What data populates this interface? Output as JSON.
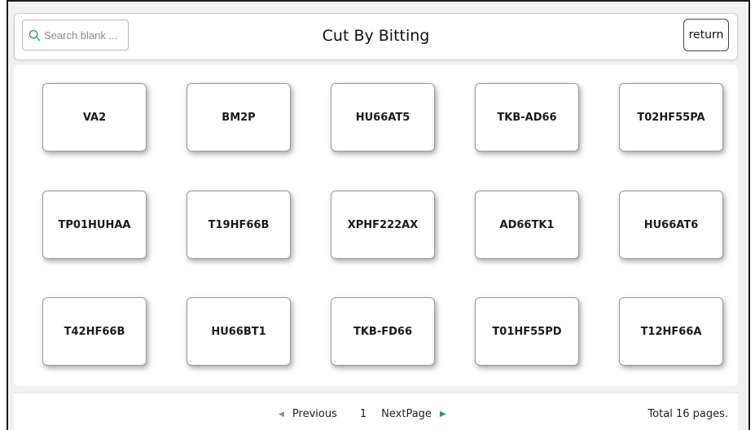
{
  "header": {
    "title": "Cut By Bitting",
    "search_placeholder": "Search blank ...",
    "return_label": "return"
  },
  "keys": [
    [
      "VA2",
      "BM2P",
      "HU66AT5",
      "TKB-AD66",
      "T02HF55PA"
    ],
    [
      "TP01HUHAA",
      "T19HF66B",
      "XPHF222AX",
      "AD66TK1",
      "HU66AT6"
    ],
    [
      "T42HF66B",
      "HU66BT1",
      "TKB-FD66",
      "T01HF55PD",
      "T12HF66A"
    ]
  ],
  "pagination": {
    "previous_label": "Previous",
    "current_page": "1",
    "next_label": "NextPage",
    "total_label": "Total 16 pages."
  },
  "colors": {
    "next_arrow": "#2aa35a",
    "prev_arrow": "#8f8f8f"
  }
}
